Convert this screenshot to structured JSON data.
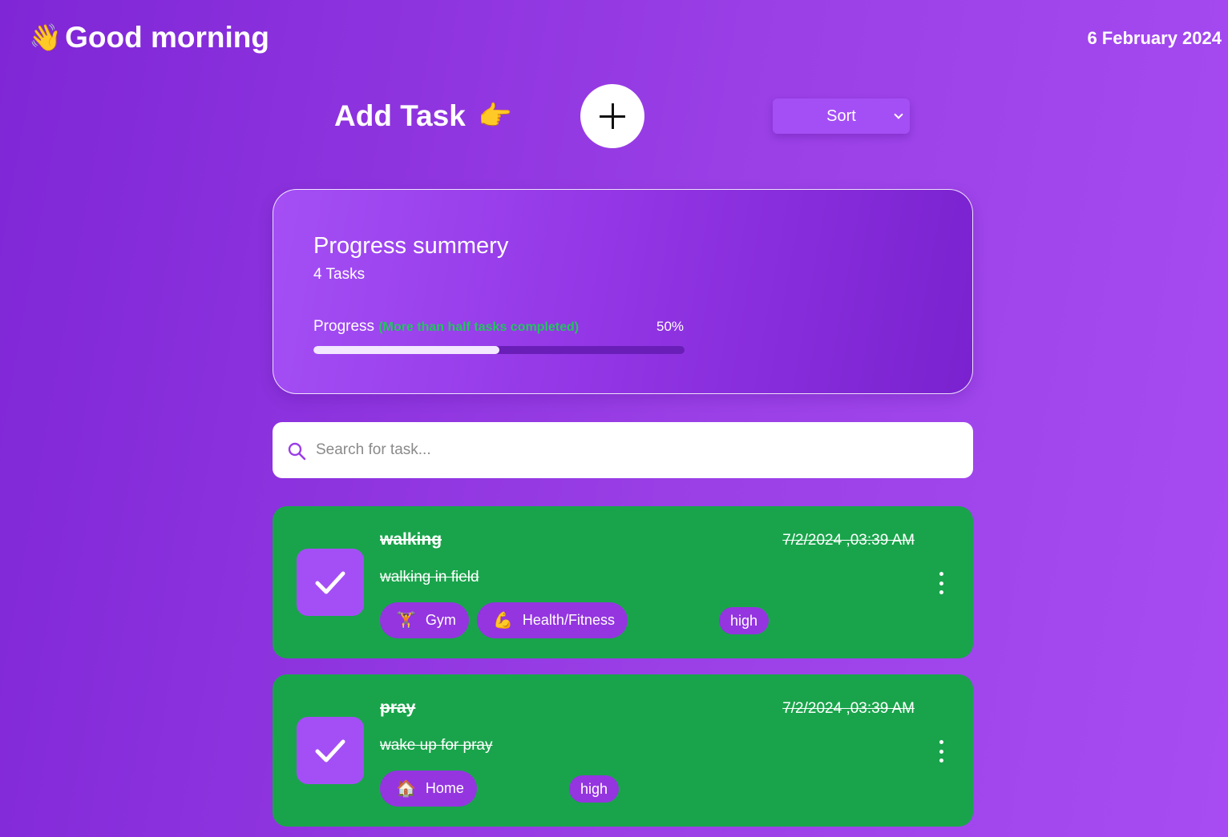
{
  "header": {
    "greeting_emoji": "👋",
    "greeting": "Good morning",
    "date": "6 February 2024"
  },
  "toolbar": {
    "add_task_label": "Add Task",
    "add_task_emoji": "👉",
    "sort_label": "Sort"
  },
  "summary": {
    "title": "Progress summery",
    "task_count": "4 Tasks",
    "progress_label": "Progress",
    "progress_note": "(More than half tasks completed)",
    "progress_percent_text": "50%",
    "progress_value": 0.5
  },
  "search": {
    "placeholder": "Search for task...",
    "value": ""
  },
  "tasks": [
    {
      "title": "walking",
      "time": "7/2/2024 ,03:39 AM",
      "description": "walking in field",
      "categories": [
        {
          "emoji": "🏋️",
          "label": "Gym"
        },
        {
          "emoji": "💪",
          "label": "Health/Fitness"
        }
      ],
      "priority": "high",
      "completed": true
    },
    {
      "title": "pray",
      "time": "7/2/2024 ,03:39 AM",
      "description": "wake up for pray",
      "categories": [
        {
          "emoji": "🏠",
          "label": "Home"
        }
      ],
      "priority": "high",
      "completed": true
    }
  ],
  "colors": {
    "background_start": "#7f26d6",
    "background_end": "#a64cf2",
    "accent_purple": "#a44ff5",
    "task_completed_green": "#19a44b",
    "progress_note_green": "#22c55e"
  }
}
